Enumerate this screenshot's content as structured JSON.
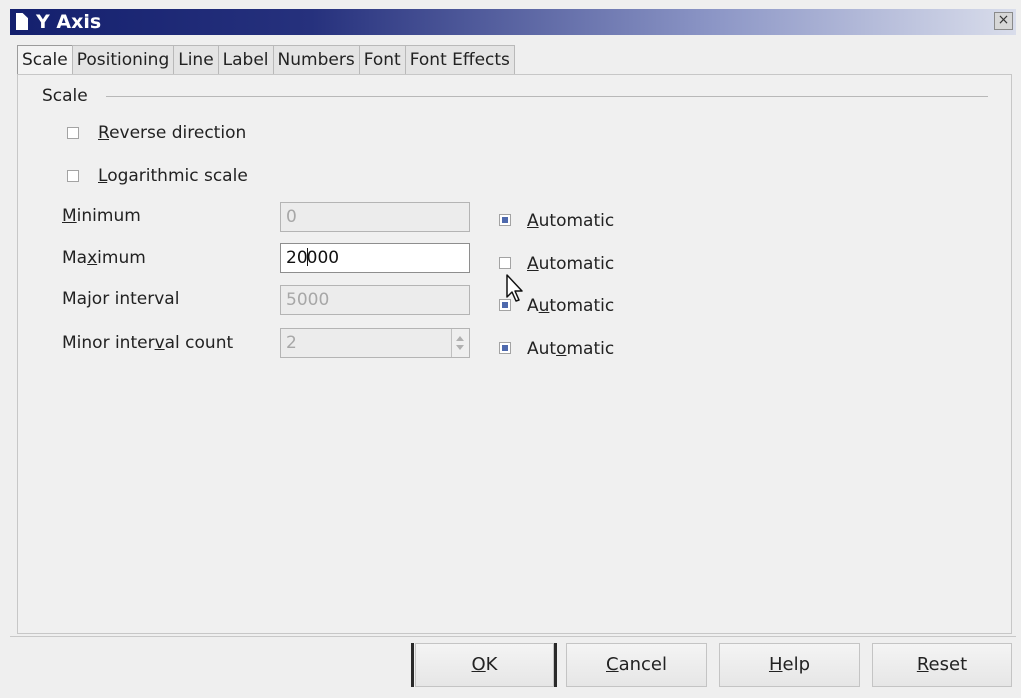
{
  "window": {
    "title": "Y Axis",
    "close_label": "×"
  },
  "tabs": [
    {
      "label": "Scale",
      "active": true
    },
    {
      "label": "Positioning"
    },
    {
      "label": "Line"
    },
    {
      "label": "Label"
    },
    {
      "label": "Numbers"
    },
    {
      "label": "Font"
    },
    {
      "label": "Font Effects"
    }
  ],
  "scale": {
    "group_label": "Scale",
    "reverse_direction": {
      "label_pre": "",
      "mnemonic": "R",
      "label_post": "everse direction",
      "checked": false
    },
    "logarithmic_scale": {
      "label_pre": "",
      "mnemonic": "L",
      "label_post": "ogarithmic scale",
      "checked": false
    },
    "rows": [
      {
        "label_pre": "",
        "mnemonic": "M",
        "label_post": "inimum",
        "value": "0",
        "enabled": false,
        "auto_pre": "",
        "auto_mnemonic": "A",
        "auto_post": "utomatic",
        "auto_checked": true
      },
      {
        "label_pre": "Ma",
        "mnemonic": "x",
        "label_post": "imum",
        "value_pre": "20",
        "value_post": "000",
        "enabled": true,
        "auto_pre": "",
        "auto_mnemonic": "A",
        "auto_post": "utomatic",
        "auto_checked": false
      },
      {
        "label_pre": "Major interval",
        "mnemonic": "",
        "label_post": "",
        "value": "5000",
        "enabled": false,
        "auto_pre": "A",
        "auto_mnemonic": "u",
        "auto_post": "tomatic",
        "auto_checked": true
      },
      {
        "label_pre": "Minor inter",
        "mnemonic": "v",
        "label_post": "al count",
        "value": "2",
        "enabled": false,
        "auto_pre": "Aut",
        "auto_mnemonic": "o",
        "auto_post": "matic",
        "auto_checked": true
      }
    ]
  },
  "buttons": {
    "ok": {
      "pre": "",
      "mnemonic": "O",
      "post": "K"
    },
    "cancel": {
      "pre": "",
      "mnemonic": "C",
      "post": "ancel"
    },
    "help": {
      "pre": "",
      "mnemonic": "H",
      "post": "elp"
    },
    "reset": {
      "pre": "",
      "mnemonic": "R",
      "post": "eset"
    }
  }
}
